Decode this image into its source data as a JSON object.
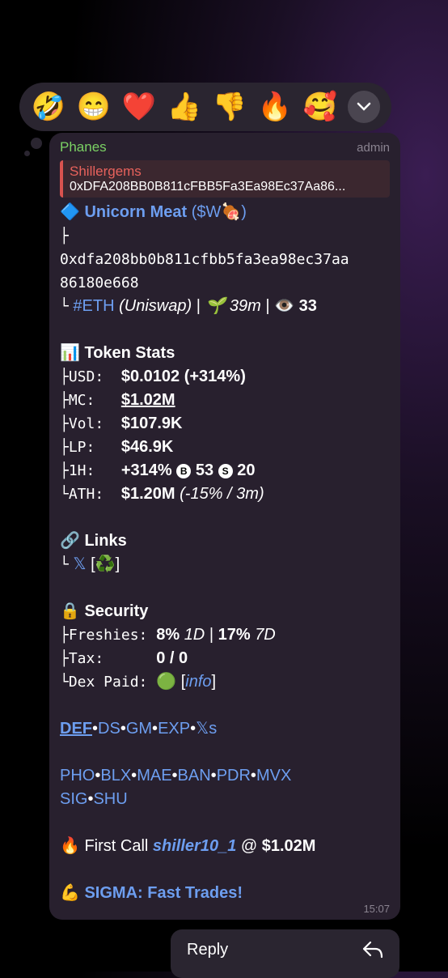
{
  "reactions": [
    "🤣",
    "😁",
    "❤️",
    "👍",
    "👎",
    "🔥",
    "🥰"
  ],
  "message": {
    "sender": "Phanes",
    "role": "admin",
    "reply": {
      "name": "Shillergems",
      "text": "0xDFA208BB0B811cFBB5Fa3Ea98Ec37Aa86..."
    },
    "token_icon": "🔷",
    "token_name": "Unicorn Meat",
    "token_symbol": "($W🍖)",
    "tree_branch": "├",
    "address_line1": "0xdfa208bb0b811cfbb5fa3ea98ec37aa",
    "address_line2": "86180e668",
    "chain_prefix": "└",
    "chain_tag": "#ETH",
    "dex": "(Uniswap)",
    "age": "🌱 39m",
    "views": "👁️ 33",
    "sep": "|",
    "stats_title": "📊 Token Stats",
    "stats": {
      "usd_label": "├USD:  ",
      "usd_value": "$0.0102 (+314%)",
      "mc_label": "├MC:   ",
      "mc_value": "$1.02M",
      "vol_label": "├Vol:  ",
      "vol_value": "$107.9K",
      "lp_label": "├LP:   ",
      "lp_value": "$46.9K",
      "h1_label": "├1H:   ",
      "h1_value": "+314%",
      "h1_b_icon": "B",
      "h1_b_count": "53",
      "h1_s_icon": "S",
      "h1_s_count": "20",
      "ath_label": "└ATH:  ",
      "ath_value": "$1.20M",
      "ath_extra": "(-15% / 3m)"
    },
    "links_title": "🔗 Links",
    "links_prefix": "└",
    "links_x": "𝕏",
    "links_bracket_open": "[",
    "links_recycle": "♻️",
    "links_bracket_close": "]",
    "security_title": "🔒 Security",
    "security": {
      "freshies_label": "├Freshies: ",
      "freshies_1d": "8%",
      "freshies_1d_tag": "1D",
      "freshies_sep": "|",
      "freshies_7d": "17%",
      "freshies_7d_tag": "7D",
      "tax_label": "├Tax:      ",
      "tax_value": "0 / 0",
      "dex_label": "└Dex Paid: ",
      "dex_icon": "🟢",
      "dex_open": "[",
      "dex_info": "info",
      "dex_close": "]"
    },
    "links_row1": [
      "DEF",
      "DS",
      "GM",
      "EXP",
      "𝕏s"
    ],
    "links_row2": [
      "PHO",
      "BLX",
      "MAE",
      "BAN",
      "PDR",
      "MVX"
    ],
    "links_row3": [
      "SIG",
      "SHU"
    ],
    "dot": "•",
    "first_call_prefix": "🔥 First Call ",
    "first_call_user": "shiller10_1",
    "first_call_at": " @ ",
    "first_call_mc": "$1.02M",
    "sigma": "💪 SIGMA: Fast Trades!",
    "time": "15:07"
  },
  "reply_bar": {
    "label": "Reply"
  }
}
